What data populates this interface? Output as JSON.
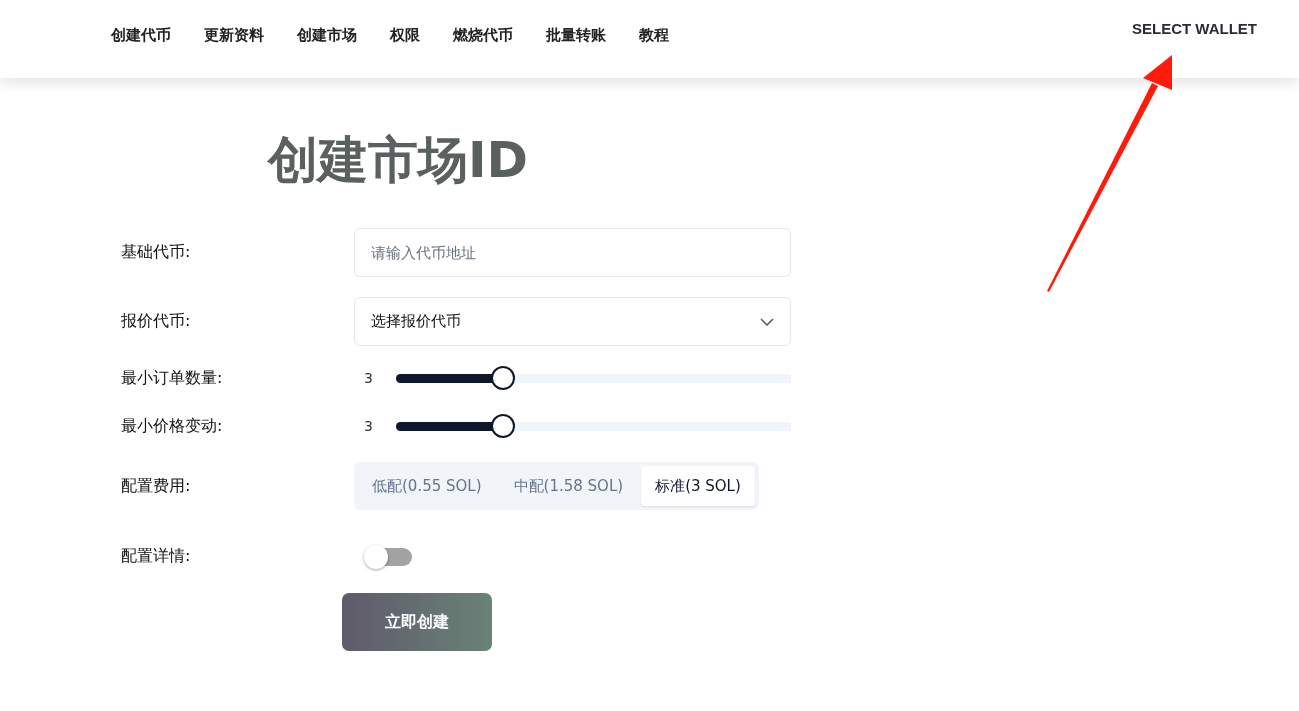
{
  "nav": {
    "items": [
      "创建代币",
      "更新资料",
      "创建市场",
      "权限",
      "燃烧代币",
      "批量转账",
      "教程"
    ],
    "wallet_button": "SELECT WALLET"
  },
  "title": "创建市场ID",
  "form": {
    "fields": [
      {
        "kind": "input",
        "label": "基础代币:",
        "placeholder": "请输入代币地址"
      },
      {
        "kind": "select",
        "label": "报价代币:",
        "value": "选择报价代币"
      },
      {
        "kind": "slider",
        "label": "最小订单数量:",
        "value": "3",
        "level": 0.27
      },
      {
        "kind": "slider",
        "label": "最小价格变动:",
        "value": "3",
        "level": 0.27
      },
      {
        "kind": "segmented",
        "label": "配置费用:",
        "options": [
          {
            "label": "低配(0.55 SOL)",
            "selected": false
          },
          {
            "label": "中配(1.58 SOL)",
            "selected": false
          },
          {
            "label": "标准(3 SOL)",
            "selected": true
          }
        ]
      },
      {
        "kind": "toggle",
        "label": "配置详情:",
        "on": false
      }
    ],
    "submit": "立即创建"
  }
}
